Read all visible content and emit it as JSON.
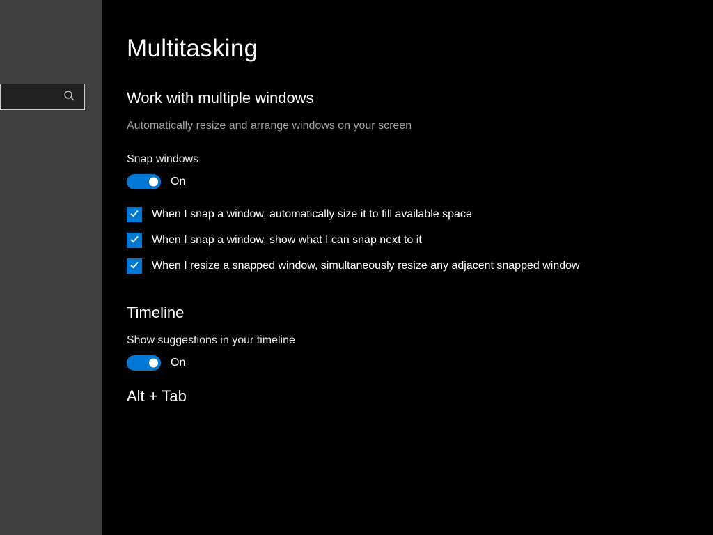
{
  "page": {
    "title": "Multitasking"
  },
  "section_windows": {
    "heading": "Work with multiple windows",
    "desc": "Automatically resize and arrange windows on your screen",
    "snap_label": "Snap windows",
    "snap_toggle_state": "On",
    "checks": [
      "When I snap a window, automatically size it to fill available space",
      "When I snap a window, show what I can snap next to it",
      "When I resize a snapped window, simultaneously resize any adjacent snapped window"
    ]
  },
  "section_timeline": {
    "heading": "Timeline",
    "suggestions_label": "Show suggestions in your timeline",
    "suggestions_toggle_state": "On"
  },
  "section_alttab": {
    "heading": "Alt + Tab"
  }
}
